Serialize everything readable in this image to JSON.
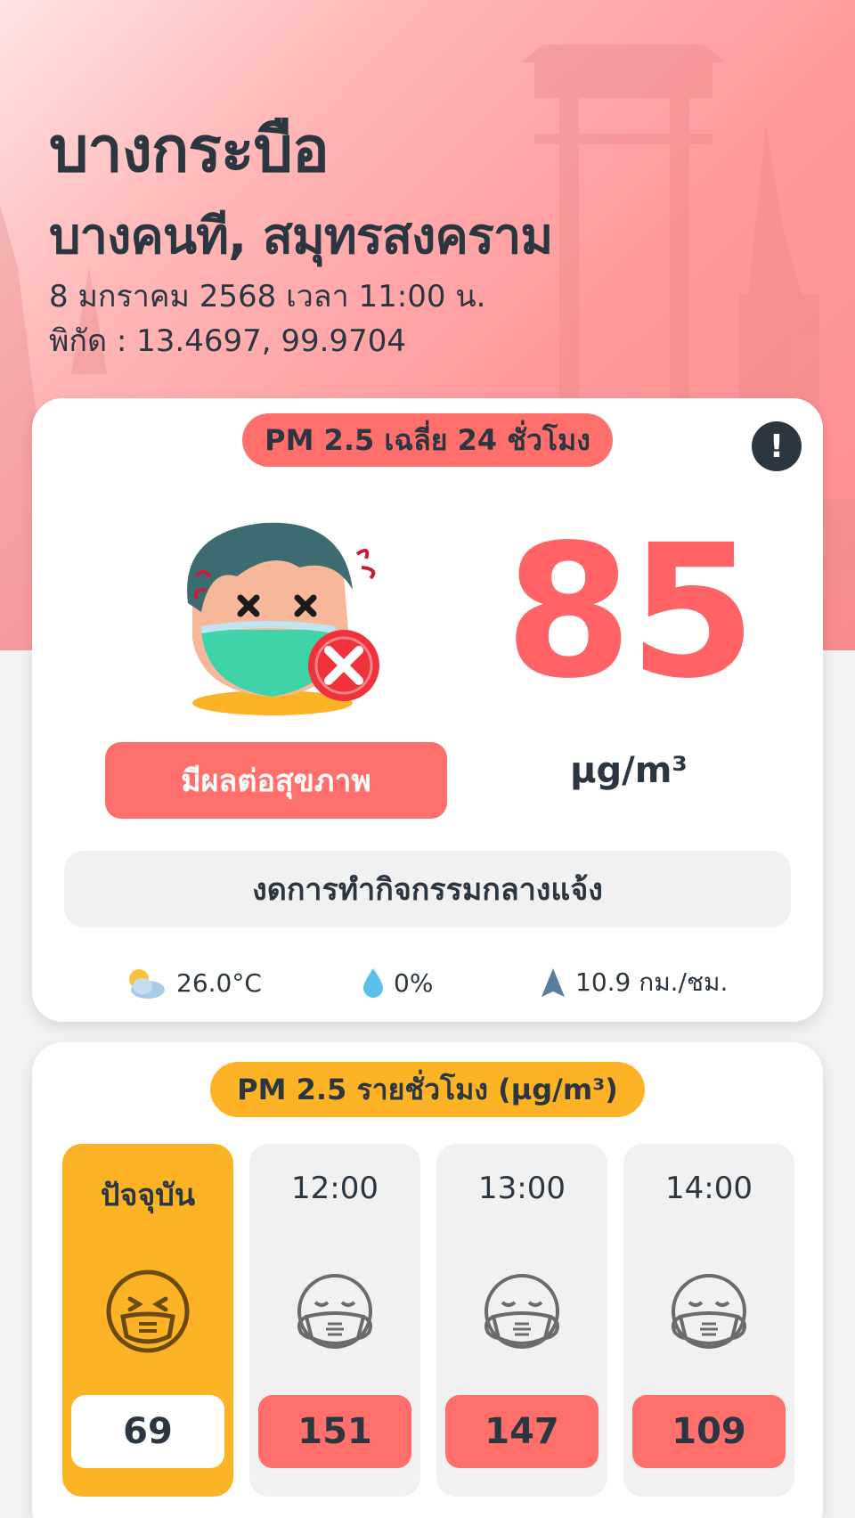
{
  "location": {
    "subdistrict": "บางกระบือ",
    "district_province": "บางคนที, สมุทรสงคราม",
    "datetime": "8 มกราคม 2568  เวลา 11:00 น.",
    "coordinates": "พิกัด : 13.4697, 99.9704"
  },
  "current": {
    "heading": "PM 2.5 เฉลี่ย 24 ชั่วโมง",
    "info_icon": "!",
    "value": "85",
    "unit": "µg/m³",
    "status": "มีผลต่อสุขภาพ",
    "advice": "งดการทำกิจกรรมกลางแจ้ง",
    "status_color": "#ff6f6c",
    "illustration": "sick-face-mask-x-icon"
  },
  "weather": {
    "temperature": "26.0°C",
    "rain": "0%",
    "wind": "10.9 กม./ชม.",
    "icons": [
      "partly-cloudy-icon",
      "raindrop-icon",
      "wind-direction-icon"
    ]
  },
  "hourly": {
    "heading": "PM 2.5 รายชั่วโมง  (µg/m³)",
    "items": [
      {
        "label": "ปัจจุบัน",
        "value": "69",
        "icon": "mask-face-squint-icon",
        "bg": "#fcb426"
      },
      {
        "label": "12:00",
        "value": "151",
        "icon": "mask-face-sleepy-icon",
        "bg": "#ff6f6c"
      },
      {
        "label": "13:00",
        "value": "147",
        "icon": "mask-face-sleepy-icon",
        "bg": "#ff6f6c"
      },
      {
        "label": "14:00",
        "value": "109",
        "icon": "mask-face-sleepy-icon",
        "bg": "#ff6f6c"
      }
    ]
  },
  "colors": {
    "accent_red": "#ff6f6c",
    "value_red": "#ff6366",
    "accent_yellow": "#fcb426",
    "text_dark": "#2b3640"
  }
}
